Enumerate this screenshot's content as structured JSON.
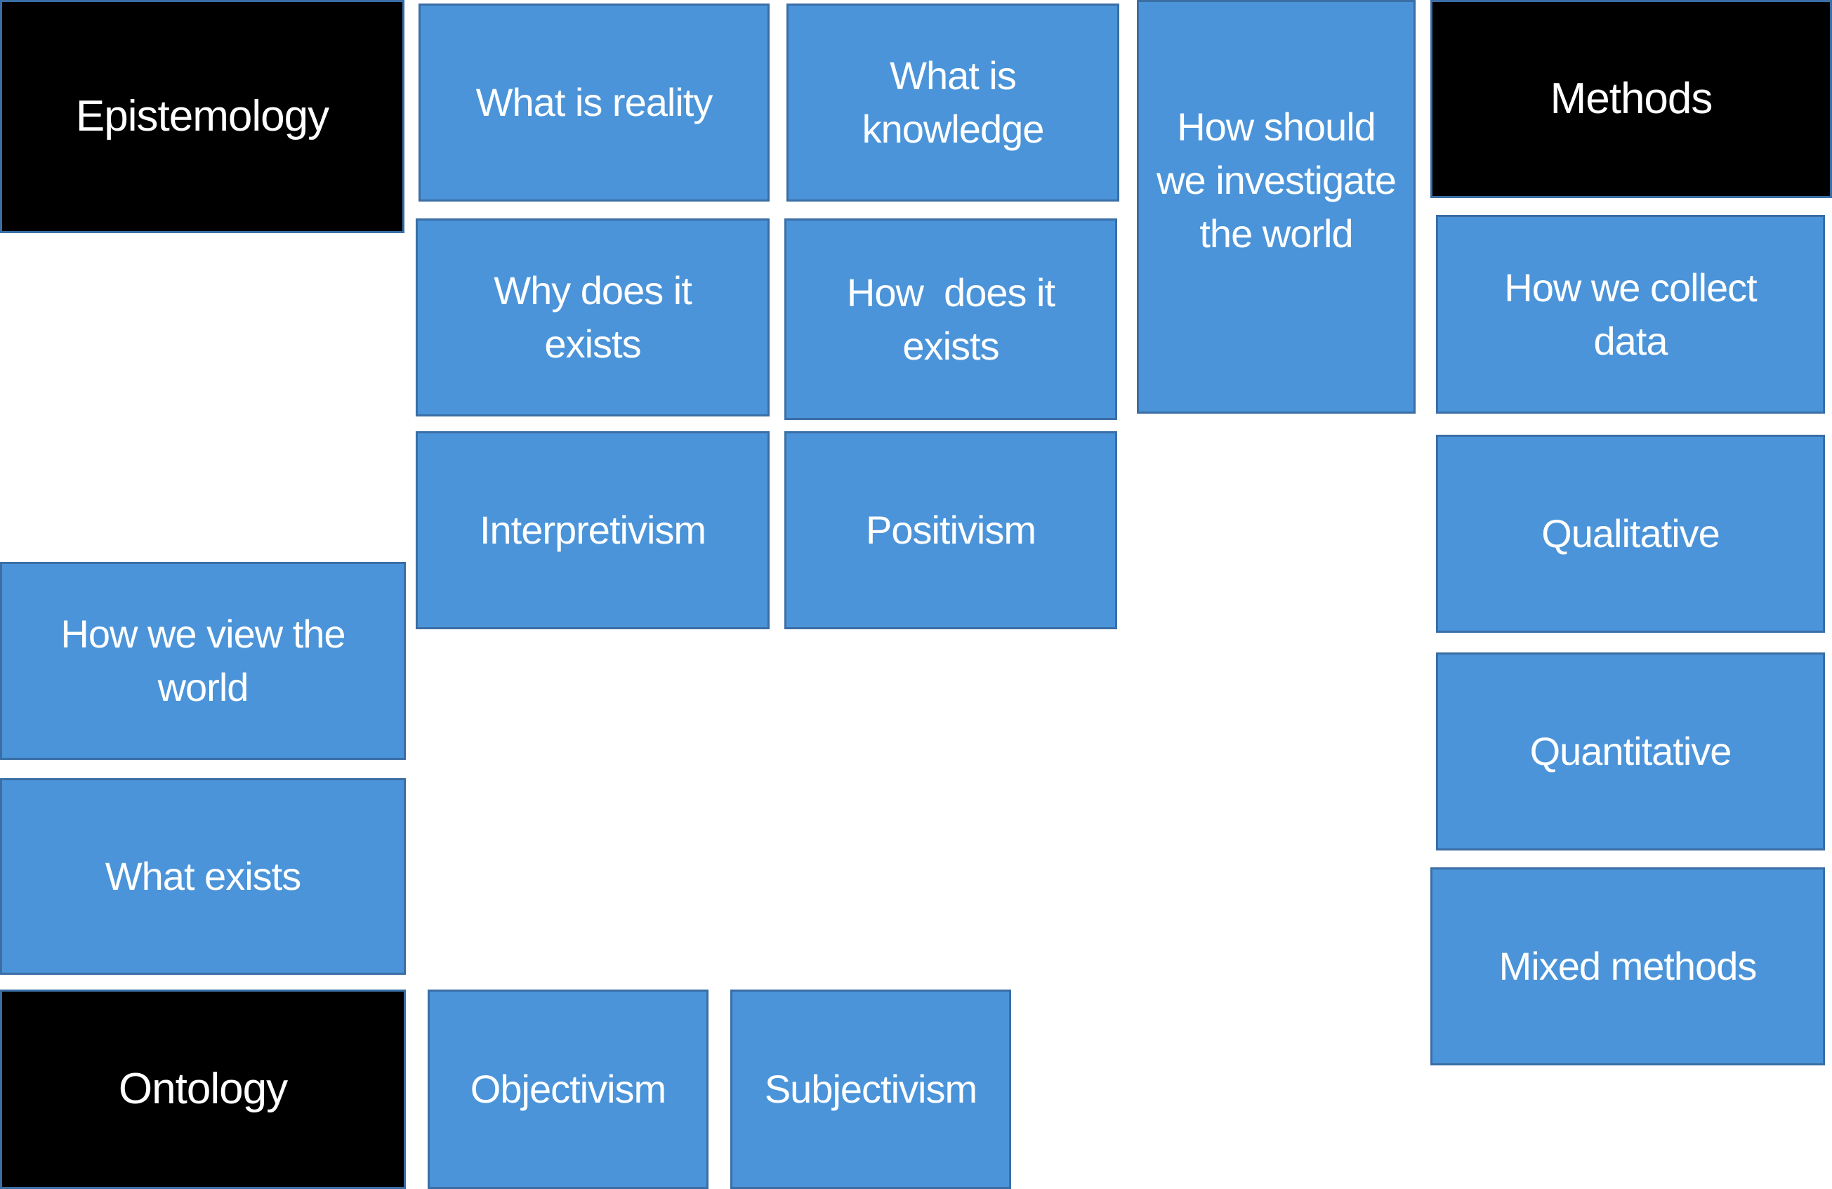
{
  "colors": {
    "concept_fill": "#4b94d9",
    "heading_fill": "#000000",
    "border": "#3a6ea5",
    "text": "#ffffff"
  },
  "headings": {
    "epistemology": "Epistemology",
    "methods": "Methods",
    "ontology": "Ontology"
  },
  "boxes": {
    "what_is_reality": "What is reality",
    "what_is_knowledge": "What is knowledge",
    "how_should_we_investigate": "How should we investigate the world",
    "why_does_it_exists": "Why does it exists",
    "how_does_it_exists": "How  does it exists",
    "how_we_collect_data": "How we collect data",
    "interpretivism": "Interpretivism",
    "positivism": "Positivism",
    "qualitative": "Qualitative",
    "how_we_view_the_world": "How we view the world",
    "quantitative": "Quantitative",
    "what_exists": "What exists",
    "mixed_methods": "Mixed methods",
    "objectivism": "Objectivism",
    "subjectivism": "Subjectivism"
  }
}
